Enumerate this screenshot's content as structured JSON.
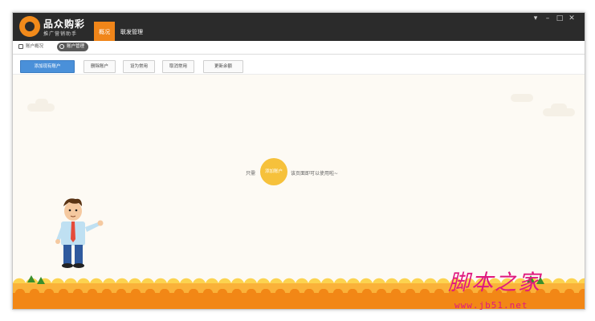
{
  "app": {
    "title": "品众购彩",
    "subtitle": "推广营销助手"
  },
  "nav": {
    "tabs": [
      {
        "label": "概况",
        "active": true
      },
      {
        "label": "联发管理",
        "active": false
      }
    ]
  },
  "window_controls": {
    "menu": "▾",
    "minimize": "–",
    "maximize": "□",
    "close": "✕"
  },
  "subnav": {
    "tabs": [
      {
        "label": "账户概况",
        "icon": "grid-icon",
        "active": false
      },
      {
        "label": "账户管理",
        "icon": "user-icon",
        "active": true
      }
    ]
  },
  "toolbar": {
    "buttons": [
      {
        "label": "添加现有账户",
        "primary": true
      },
      {
        "label": "删除账户",
        "primary": false
      },
      {
        "label": "设为常用",
        "primary": false
      },
      {
        "label": "取消常用",
        "primary": false
      },
      {
        "label": "更新余额",
        "primary": false
      }
    ]
  },
  "empty_state": {
    "text_before": "只需",
    "button_label": "添加账户",
    "text_after": "该页面即可以使用啦~"
  },
  "watermark": {
    "main": "脚本之家",
    "url": "www.jb51.net"
  },
  "colors": {
    "titlebar": "#2b2b2b",
    "accent": "#f08519",
    "primary_button": "#4a90d9",
    "empty_button": "#f6c13b",
    "watermark": "#e0197f"
  }
}
